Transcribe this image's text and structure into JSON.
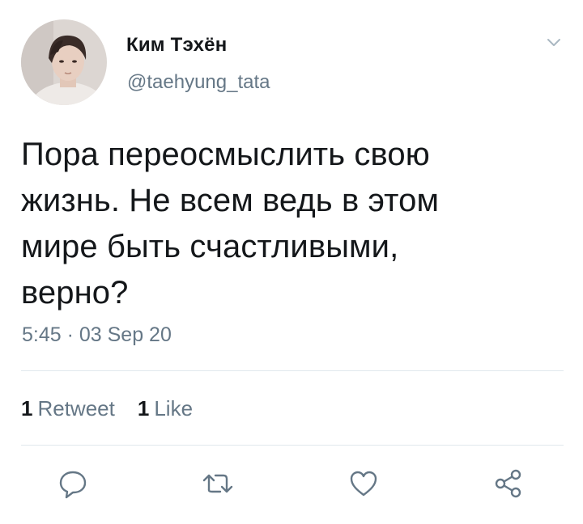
{
  "user": {
    "display_name": "Ким Тэхён",
    "handle": "@taehyung_tata"
  },
  "tweet": {
    "text_lines": [
      "Пора переосмыслить свою",
      "жизнь. Не всем ведь в этом",
      "мире быть счастливыми,",
      "верно?"
    ],
    "timestamp": "5:45 · 03 Sep 20"
  },
  "stats": {
    "retweets_count": "1",
    "retweets_label": "Retweet",
    "likes_count": "1",
    "likes_label": "Like"
  },
  "actions": [
    {
      "icon": "reply-icon"
    },
    {
      "icon": "retweet-icon"
    },
    {
      "icon": "like-icon"
    },
    {
      "icon": "share-icon"
    }
  ],
  "colors": {
    "text_primary": "#14171a",
    "text_secondary": "#657786",
    "divider": "#e1e8ed",
    "icon": "#657786"
  }
}
